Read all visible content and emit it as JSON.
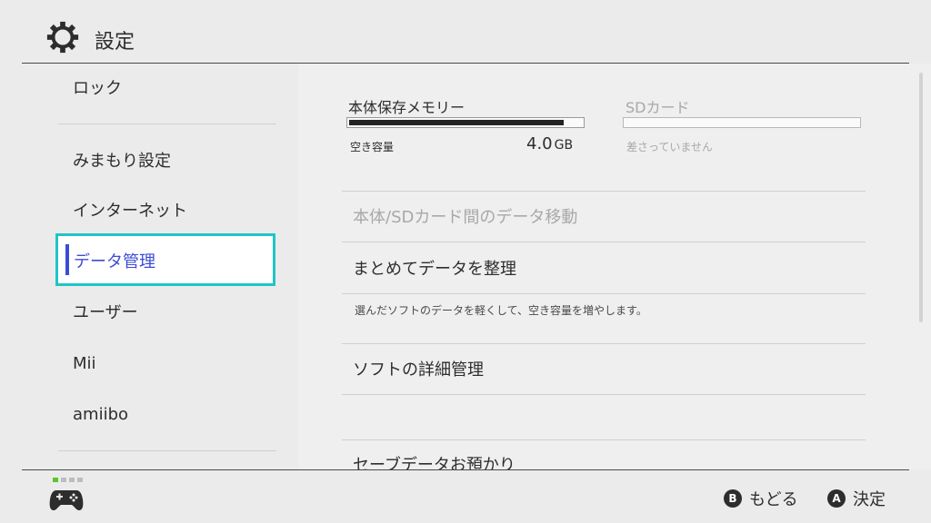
{
  "header": {
    "title": "設定",
    "icon": "gear-icon"
  },
  "sidebar": {
    "items": [
      {
        "label": "ロック"
      },
      {
        "label": "みまもり設定"
      },
      {
        "label": "インターネット"
      },
      {
        "label": "データ管理",
        "selected": true
      },
      {
        "label": "ユーザー"
      },
      {
        "label": "Mii"
      },
      {
        "label": "amiibo"
      }
    ]
  },
  "storage": {
    "internal": {
      "title": "本体保存メモリー",
      "free_label": "空き容量",
      "free_value": "4.0",
      "free_unit": "GB",
      "used_fraction": 0.92
    },
    "sd": {
      "title": "SDカード",
      "status": "差さっていません"
    }
  },
  "main": {
    "rows": [
      {
        "label": "本体/SDカード間のデータ移動",
        "disabled": true
      },
      {
        "label": "まとめてデータを整理",
        "description": "選んだソフトのデータを軽くして、空き容量を増やします。"
      },
      {
        "label": "ソフトの詳細管理"
      },
      {
        "label": "セーブデータお預かり"
      }
    ]
  },
  "footer": {
    "back": {
      "button": "B",
      "label": "もどる"
    },
    "confirm": {
      "button": "A",
      "label": "決定"
    }
  },
  "colors": {
    "accent": "#3c4bd6",
    "selection_border": "#1fc5c8",
    "active_dot": "#58c728"
  }
}
